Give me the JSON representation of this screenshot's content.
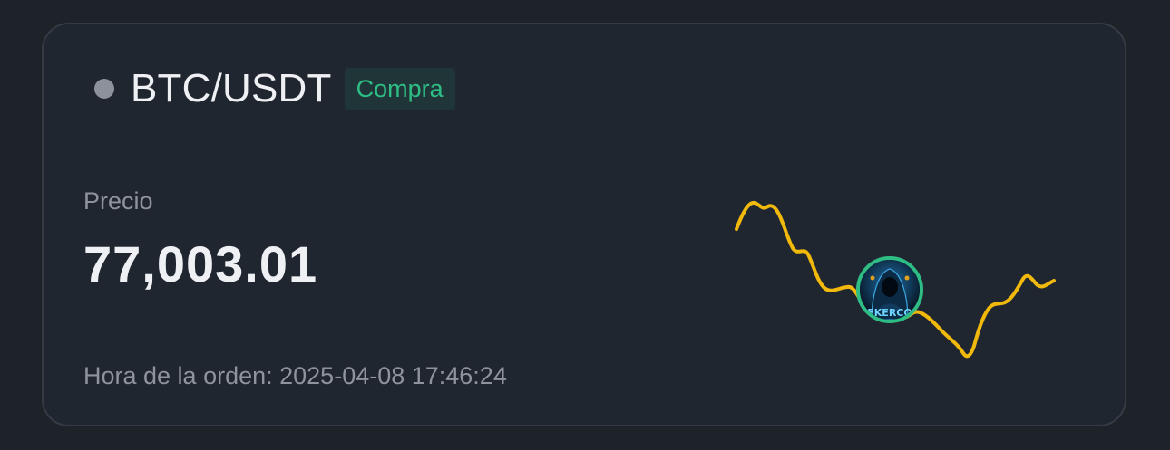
{
  "pair": "BTC/USDT",
  "side_label": "Compra",
  "price_label": "Precio",
  "price_value": "77,003.01",
  "order_time": "Hora de la orden: 2025-04-08 17:46:24",
  "colors": {
    "background": "#1e2229",
    "card": "#202630",
    "buy": "#2ebd85",
    "sparkline": "#f0b90b",
    "muted_text": "#8e939c"
  },
  "avatar": {
    "icon": "hooded-hacker-avatar-icon",
    "text": "EKERCO"
  },
  "sparkline_icon": "price-sparkline"
}
